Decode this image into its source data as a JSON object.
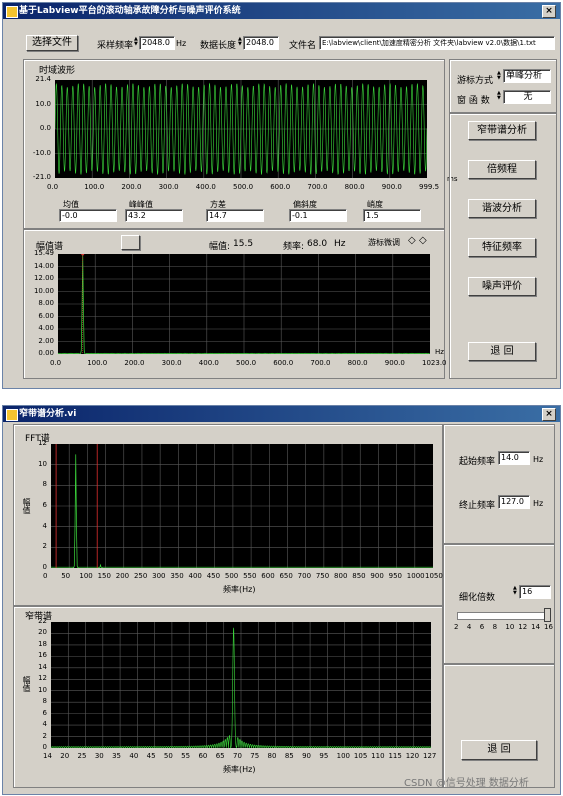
{
  "win1": {
    "title": "基于Labview平台的滚动轴承故障分析与噪声评价系统",
    "select_file": "选择文件",
    "sample_rate_label": "采样频率",
    "sample_rate_value": "2048.0",
    "sample_rate_unit": "Hz",
    "data_len_label": "数据长度",
    "data_len_value": "2048.0",
    "filename_label": "文件名",
    "filename_value": "E:\\labview\\client\\加速度精密分析 文件夹\\labview v2.0\\数据\\1.txt",
    "time_plot": {
      "title": "时域波形",
      "y_ticks": [
        "21.4",
        "10.0",
        "0.0",
        "-10.0",
        "-21.0"
      ],
      "x_ticks": [
        "0.0",
        "100.0",
        "200.0",
        "300.0",
        "400.0",
        "500.0",
        "600.0",
        "700.0",
        "800.0",
        "900.0",
        "999.5"
      ],
      "x_unit": "ms"
    },
    "stats": [
      {
        "label": "均值",
        "value": "-0.0"
      },
      {
        "label": "峰峰值",
        "value": "43.2"
      },
      {
        "label": "方差",
        "value": "14.7"
      },
      {
        "label": "偏斜度",
        "value": "-0.1"
      },
      {
        "label": "峭度",
        "value": "1.5"
      }
    ],
    "spectrum": {
      "title": "幅值谱",
      "amp_label": "幅值:",
      "amp_value": "15.5",
      "freq_label": "频率:",
      "freq_value": "68.0",
      "freq_unit": "Hz",
      "cursor_adjust": "游标微调",
      "y_ticks": [
        "15.49",
        "14.00",
        "12.00",
        "10.00",
        "8.00",
        "6.00",
        "4.00",
        "2.00",
        "0.00"
      ],
      "x_ticks": [
        "0.0",
        "100.0",
        "200.0",
        "300.0",
        "400.0",
        "500.0",
        "600.0",
        "700.0",
        "800.0",
        "900.0",
        "1023.0"
      ],
      "x_unit": "Hz"
    },
    "cursor_mode_label": "游标方式",
    "cursor_mode_value": "单峰分析",
    "window_label": "窗 函 数",
    "window_value": "无",
    "buttons": [
      "窄带谱分析",
      "倍频程",
      "谐波分析",
      "特征频率",
      "噪声评价"
    ],
    "back": "退 回"
  },
  "win2": {
    "title": "窄带谱分析.vi",
    "fft": {
      "title": "FFT谱",
      "ylabel": "幅值",
      "xlabel": "频率(Hz)",
      "y_ticks": [
        "12",
        "10",
        "8",
        "6",
        "4",
        "2",
        "0"
      ],
      "x_ticks": [
        "0",
        "50",
        "100",
        "150",
        "200",
        "250",
        "300",
        "350",
        "400",
        "450",
        "500",
        "550",
        "600",
        "650",
        "700",
        "750",
        "800",
        "850",
        "900",
        "950",
        "1000",
        "1050"
      ]
    },
    "narrow": {
      "title": "窄带谱",
      "ylabel": "幅值",
      "xlabel": "频率(Hz)",
      "y_ticks": [
        "22",
        "20",
        "18",
        "16",
        "14",
        "12",
        "10",
        "8",
        "6",
        "4",
        "2",
        "0"
      ],
      "x_ticks": [
        "14",
        "20",
        "25",
        "30",
        "35",
        "40",
        "45",
        "50",
        "55",
        "60",
        "65",
        "70",
        "75",
        "80",
        "85",
        "90",
        "95",
        "100",
        "105",
        "110",
        "115",
        "120",
        "127"
      ]
    },
    "start_label": "起始频率",
    "start_value": "14.0",
    "stop_label": "终止频率",
    "stop_value": "127.0",
    "unit": "Hz",
    "refine_label": "细化倍数",
    "refine_value": "16",
    "slider_ticks": [
      "2",
      "4",
      "6",
      "8",
      "10",
      "12",
      "14",
      "16"
    ],
    "slider_value": 16,
    "back": "退 回"
  },
  "watermark": "CSDN @信号处理 数据分析",
  "colors": {
    "trace": "#3ddc3d",
    "grid": "#5a5a5a",
    "cursor": "#e03030",
    "bg": "#d4d0c8"
  }
}
